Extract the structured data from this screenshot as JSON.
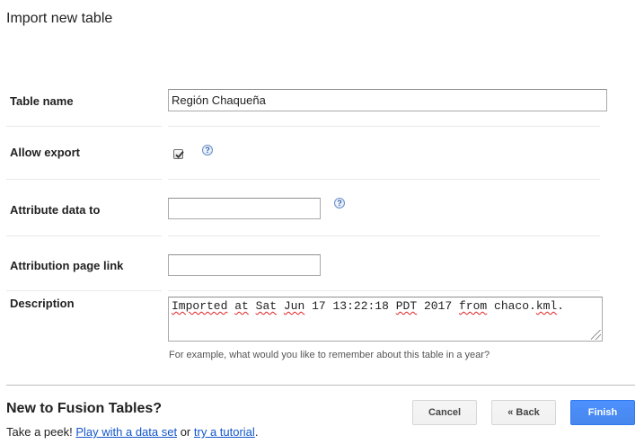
{
  "page": {
    "title": "Import new table"
  },
  "form": {
    "table_name": {
      "label": "Table name",
      "value": "Región Chaqueña"
    },
    "allow_export": {
      "label": "Allow export",
      "checked": true,
      "help_icon": "help-icon"
    },
    "attribute_data_to": {
      "label": "Attribute data to",
      "value": "",
      "help_icon": "help-icon"
    },
    "attribution_page_link": {
      "label": "Attribution page link",
      "value": ""
    },
    "description": {
      "label": "Description",
      "value_parts": [
        "Imported",
        "at",
        "Sat",
        "Jun",
        "17 13:22:18",
        "PDT",
        "2017",
        "from",
        "chaco.",
        "kml",
        "."
      ],
      "hint": "For example, what would you like to remember about this table in a year?"
    }
  },
  "footer": {
    "title": "New to Fusion Tables?",
    "peek_prefix": "Take a peek!",
    "link_dataset": "Play with a data set",
    "or_text": "or",
    "link_tutorial": "try a tutorial",
    "period": ".",
    "cancel_label": "Cancel",
    "back_label": "« Back",
    "finish_label": "Finish"
  },
  "colors": {
    "primary_button": "#4d90fe",
    "link": "#1155cc"
  }
}
